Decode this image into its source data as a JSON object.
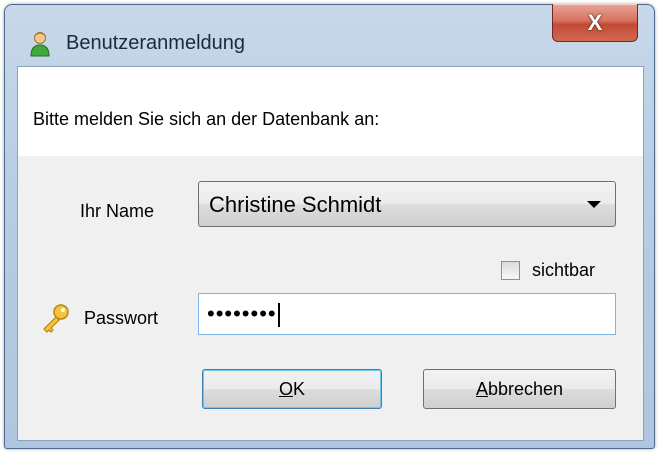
{
  "window": {
    "title": "Benutzeranmeldung",
    "close_glyph": "X"
  },
  "instruction": "Bitte melden Sie sich an der Datenbank an:",
  "name": {
    "label": "Ihr Name",
    "selected": "Christine Schmidt"
  },
  "visible_checkbox": {
    "label": "sichtbar",
    "checked": false
  },
  "password": {
    "label": "Passwort",
    "masked_value": "••••••••"
  },
  "buttons": {
    "ok_accel": "O",
    "ok_rest": "K",
    "cancel_accel": "A",
    "cancel_rest": "bbrechen"
  },
  "icons": {
    "app": "user-icon",
    "key": "key-icon"
  },
  "colors": {
    "title_bar": "#b9cde3",
    "close_button": "#c24a34",
    "focus_border": "#7eb4ea"
  }
}
